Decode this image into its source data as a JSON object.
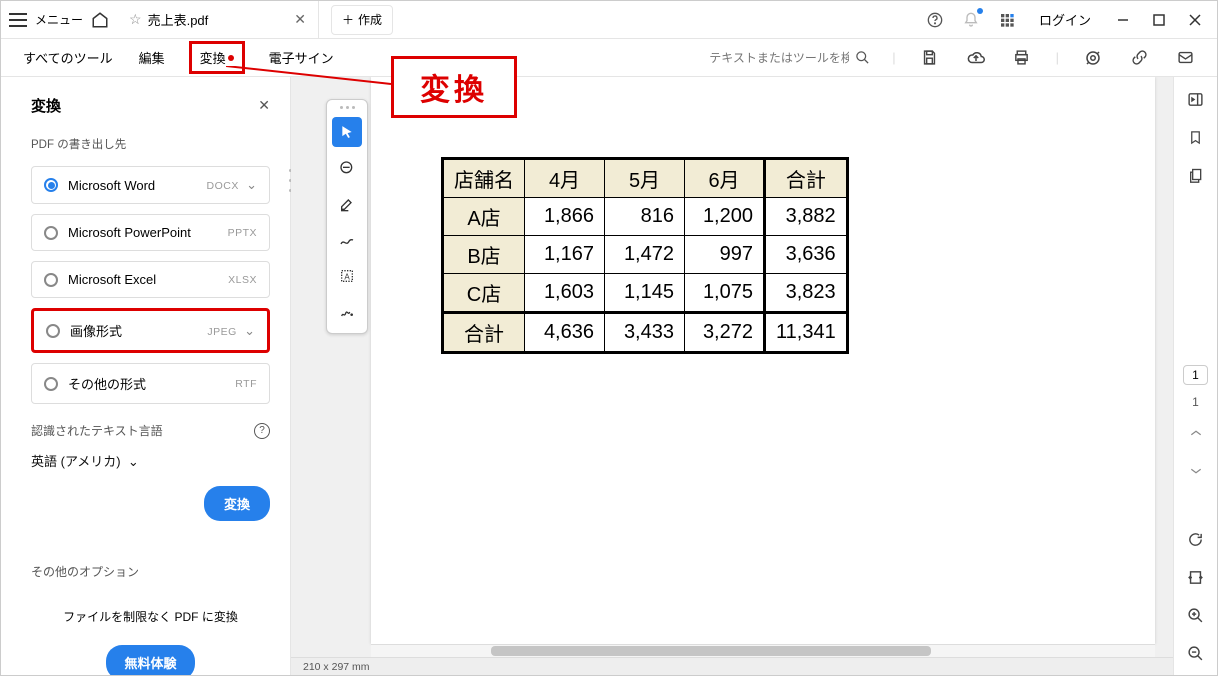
{
  "titlebar": {
    "menu_label": "メニュー",
    "tab_title": "売上表.pdf",
    "new_tab": "作成",
    "login": "ログイン"
  },
  "toolbar": {
    "all_tools": "すべてのツール",
    "edit": "編集",
    "convert": "変換",
    "esign": "電子サイン",
    "search_placeholder": "テキストまたはツールを検索"
  },
  "callout": {
    "label": "変換"
  },
  "leftpanel": {
    "title": "変換",
    "sub": "PDF の書き出し先",
    "options": [
      {
        "label": "Microsoft Word",
        "ext": "DOCX",
        "selected": true,
        "chevron": true
      },
      {
        "label": "Microsoft PowerPoint",
        "ext": "PPTX",
        "selected": false
      },
      {
        "label": "Microsoft Excel",
        "ext": "XLSX",
        "selected": false
      },
      {
        "label": "画像形式",
        "ext": "JPEG",
        "selected": false,
        "chevron": true,
        "hl": true
      },
      {
        "label": "その他の形式",
        "ext": "RTF",
        "selected": false
      }
    ],
    "lang_label": "認識されたテキスト言語",
    "lang_value": "英語 (アメリカ)",
    "convert_btn": "変換",
    "other_options": "その他のオプション",
    "trial_text": "ファイルを制限なく PDF に変換",
    "trial_btn": "無料体験"
  },
  "table": {
    "headers": [
      "店舗名",
      "4月",
      "5月",
      "6月",
      "合計"
    ],
    "rows": [
      [
        "A店",
        "1,866",
        "816",
        "1,200",
        "3,882"
      ],
      [
        "B店",
        "1,167",
        "1,472",
        "997",
        "3,636"
      ],
      [
        "C店",
        "1,603",
        "1,145",
        "1,075",
        "3,823"
      ]
    ],
    "total_row": [
      "合計",
      "4,636",
      "3,433",
      "3,272",
      "11,341"
    ]
  },
  "status": {
    "dimensions": "210 x 297 mm"
  },
  "rightbar": {
    "page": "1",
    "total": "1"
  }
}
